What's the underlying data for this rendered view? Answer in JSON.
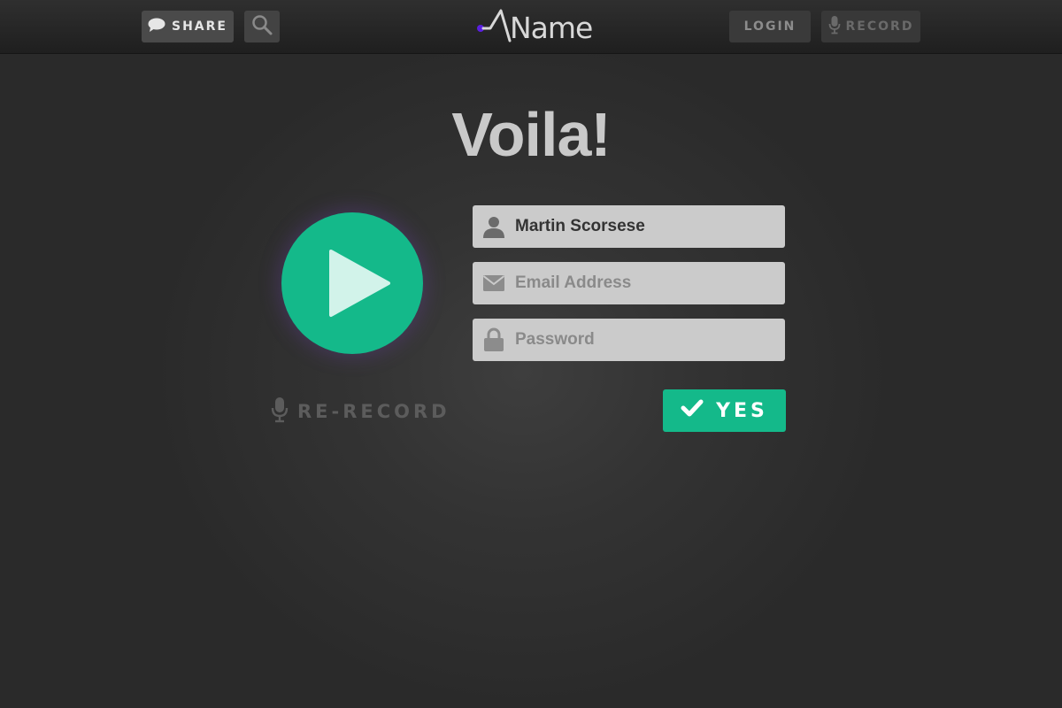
{
  "header": {
    "share_label": "SHARE",
    "login_label": "LOGIN",
    "record_label": "RECORD",
    "logo_text": "Name"
  },
  "main": {
    "title": "Voila!",
    "rerecord_label": "RE-RECORD",
    "yes_label": "YES",
    "fields": {
      "name": {
        "value": "Martin Scorsese",
        "placeholder": ""
      },
      "email": {
        "value": "",
        "placeholder": "Email Address"
      },
      "password": {
        "value": "",
        "placeholder": "Password"
      }
    }
  },
  "icons": {
    "share": "speech-bubble-icon",
    "search": "search-icon",
    "record": "microphone-icon",
    "play": "play-icon",
    "user": "user-icon",
    "email": "envelope-icon",
    "password": "lock-icon",
    "yes": "checkmark-icon"
  },
  "colors": {
    "accent": "#14b98a",
    "logo_dot": "#5a1fe0",
    "background": "#2f2f2f"
  }
}
